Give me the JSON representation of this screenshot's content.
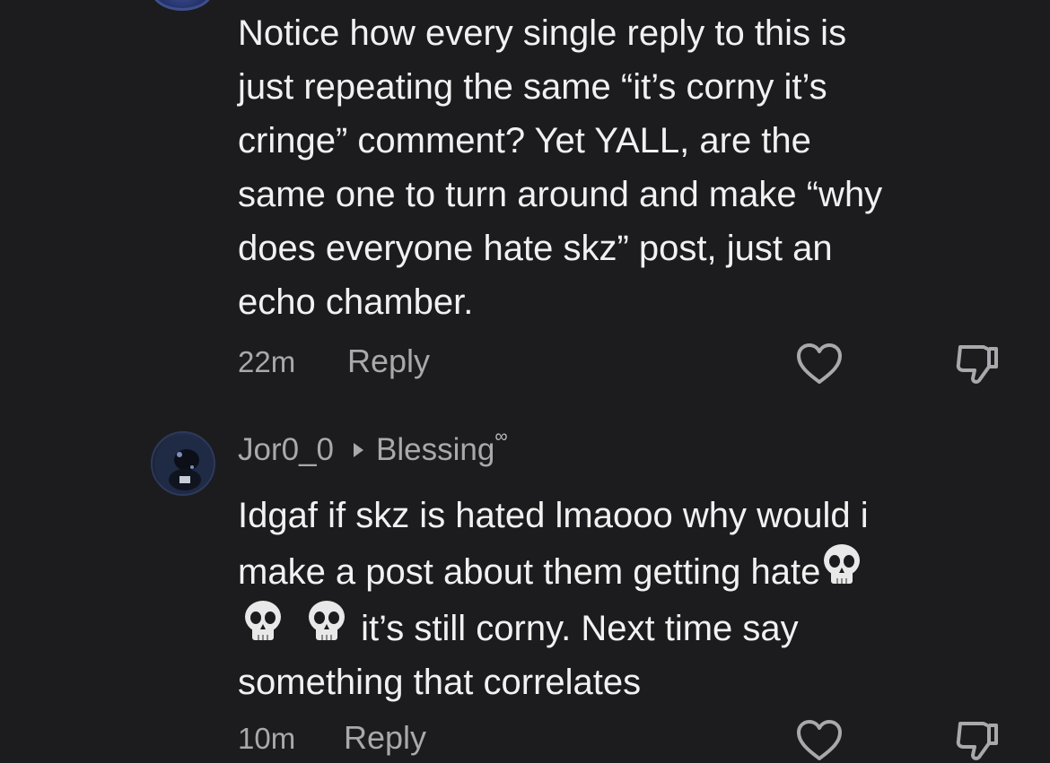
{
  "comments": [
    {
      "text": "Notice how every single reply to this is\njust repeating the same “it’s corny it’s\ncringe” comment? Yet YALL, are the\nsame one to turn around and make “why\ndoes everyone hate skz” post, just an\necho chamber.",
      "timestamp": "22m",
      "reply_label": "Reply"
    },
    {
      "username": "Jor0_0",
      "reply_to": "Blessing",
      "badge": "∞",
      "text_line1": "Idgaf if skz is hated lmaooo why would i",
      "text_line2": "make a post about them getting hate",
      "text_line3": "it’s still corny. Next time say",
      "text_line4": "something that correlates",
      "timestamp": "10m",
      "reply_label": "Reply"
    }
  ],
  "icons": {
    "like": "heart-outline-icon",
    "dislike": "thumbs-down-outline-icon",
    "skull": "skull-emoji-icon"
  },
  "colors": {
    "background": "#1c1c1e",
    "text": "#f1f1f1",
    "secondary": "#a9a9ad"
  }
}
